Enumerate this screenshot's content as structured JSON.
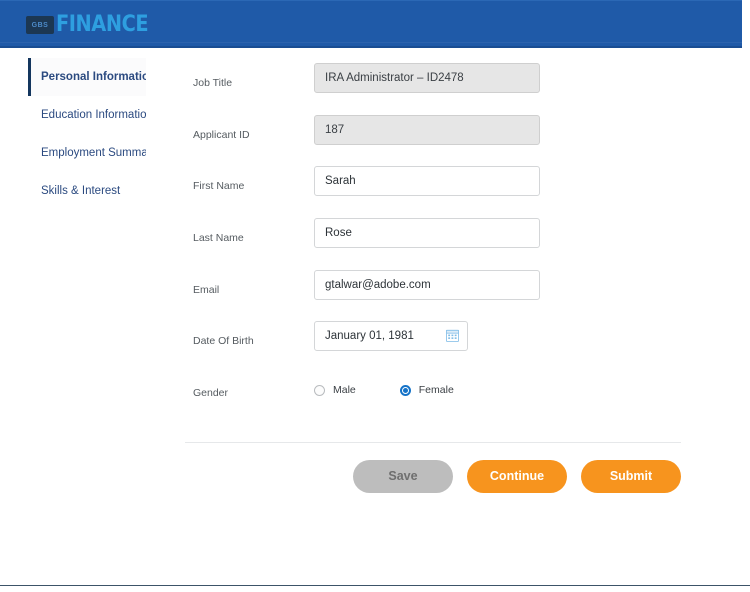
{
  "header": {
    "logo_badge": "GBS",
    "logo_text": "FINANCE",
    "brand_blue": "#1f5aa8",
    "logo_accent": "#2e9fe0"
  },
  "sidebar": {
    "items": [
      {
        "label": "Personal Information",
        "active": true
      },
      {
        "label": "Education Information",
        "active": false
      },
      {
        "label": "Employment Summary",
        "active": false
      },
      {
        "label": "Skills & Interest",
        "active": false
      }
    ]
  },
  "form": {
    "fields": [
      {
        "label": "Job Title",
        "value": "IRA Administrator – ID2478",
        "type": "text",
        "disabled": true
      },
      {
        "label": "Applicant ID",
        "value": "187",
        "type": "text",
        "disabled": true
      },
      {
        "label": "First Name",
        "value": "Sarah",
        "type": "text",
        "disabled": false
      },
      {
        "label": "Last Name",
        "value": "Rose",
        "type": "text",
        "disabled": false
      },
      {
        "label": "Email",
        "value": "gtalwar@adobe.com",
        "type": "text",
        "disabled": false
      },
      {
        "label": "Date Of Birth",
        "value": "January 01, 1981",
        "type": "date",
        "disabled": false
      },
      {
        "label": "Gender",
        "type": "radio"
      }
    ],
    "labels": {
      "job_title": "Job Title",
      "applicant_id": "Applicant ID",
      "first_name": "First Name",
      "last_name": "Last Name",
      "email": "Email",
      "date_of_birth": "Date Of Birth",
      "gender": "Gender"
    },
    "values": {
      "job_title": "IRA Administrator – ID2478",
      "applicant_id": "187",
      "first_name": "Sarah",
      "last_name": "Rose",
      "email": "gtalwar@adobe.com",
      "date_of_birth": "January 01, 1981"
    },
    "gender": {
      "options": [
        {
          "label": "Male",
          "selected": false
        },
        {
          "label": "Female",
          "selected": true
        }
      ],
      "male_label": "Male",
      "female_label": "Female",
      "selected": "Female"
    },
    "icons": {
      "date_picker": "calendar-icon"
    }
  },
  "actions": {
    "save_label": "Save",
    "continue_label": "Continue",
    "submit_label": "Submit",
    "primary_color": "#f7941e",
    "disabled_color": "#bdbdbd"
  }
}
